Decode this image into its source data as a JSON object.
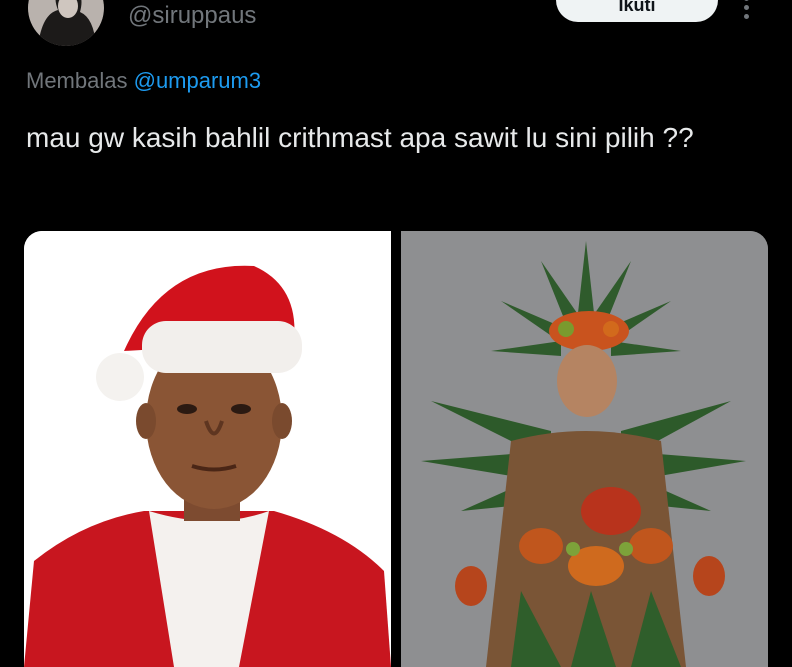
{
  "user": {
    "handle": "@siruppaus",
    "avatar_icon": "avatar-photo"
  },
  "header": {
    "follow_label": "Ikuti",
    "more_icon": "more-vertical-icon"
  },
  "reply": {
    "prefix": "Membalas",
    "mention": "@umparum3"
  },
  "tweet": {
    "text": "mau gw kasih bahlil crithmast apa sawit lu sini pilih ??"
  },
  "media": {
    "left_image": "man-in-santa-hat-photo",
    "right_image": "man-in-palm-oil-costume-photo"
  },
  "colors": {
    "background": "#000000",
    "text": "#e7e9ea",
    "muted": "#71767b",
    "link": "#1d9bf0"
  }
}
